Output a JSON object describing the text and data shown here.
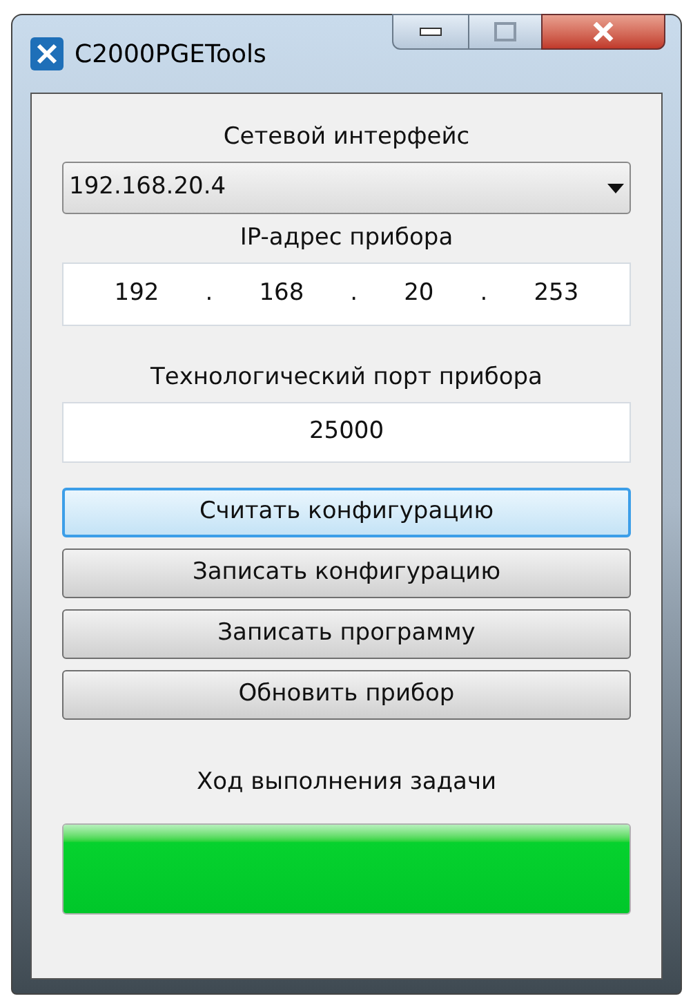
{
  "window": {
    "title": "C2000PGETools"
  },
  "network_interface": {
    "label": "Сетевой интерфейс",
    "value": "192.168.20.4"
  },
  "ip_address": {
    "label": "IP-адрес прибора",
    "octets": [
      "192",
      "168",
      "20",
      "253"
    ],
    "separators": [
      ".",
      ".",
      "."
    ]
  },
  "port": {
    "label": "Технологический порт прибора",
    "value": "25000"
  },
  "buttons": [
    {
      "label": "Считать конфигурацию",
      "focused": true
    },
    {
      "label": "Записать конфигурацию",
      "focused": false
    },
    {
      "label": "Записать программу",
      "focused": false
    },
    {
      "label": "Обновить прибор",
      "focused": false
    }
  ],
  "progress": {
    "label": "Ход выполнения задачи",
    "level": 1
  }
}
